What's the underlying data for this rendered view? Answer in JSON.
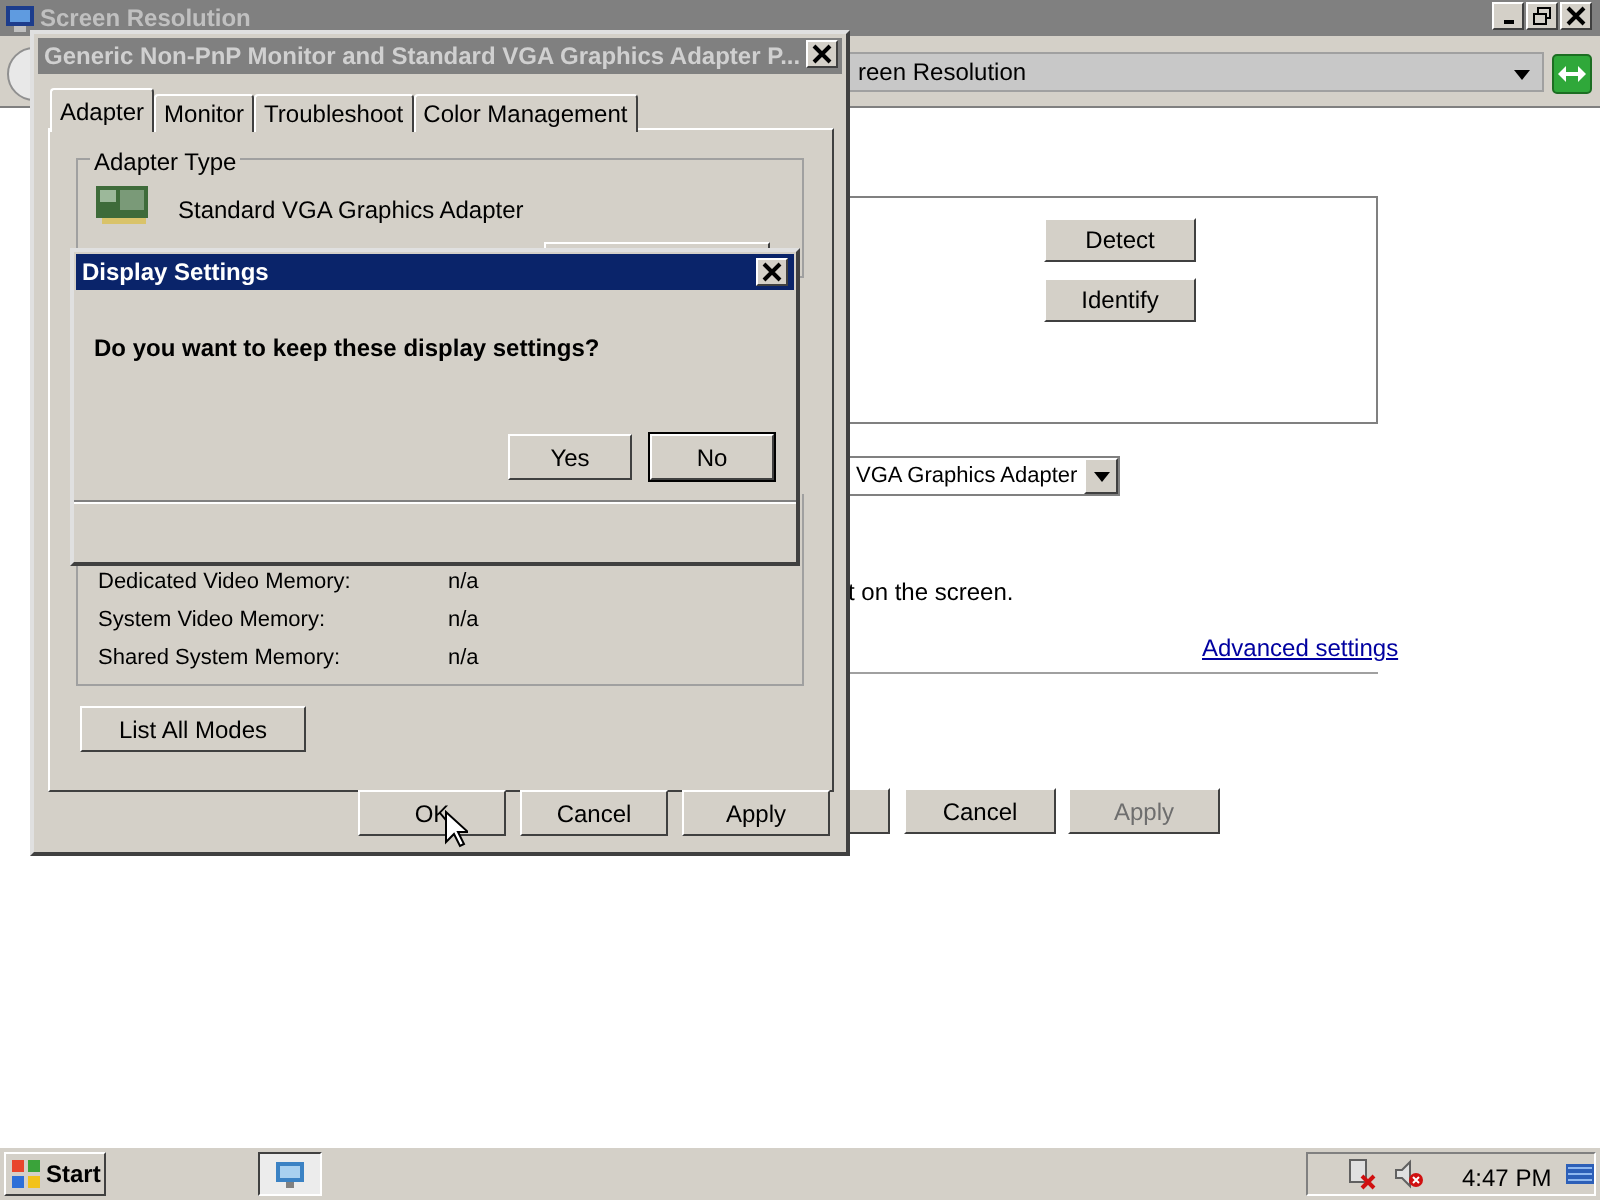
{
  "main_window": {
    "title": "Screen Resolution",
    "address": "reen Resolution",
    "buttons": [
      {
        "label": "Detect",
        "disabled": false
      },
      {
        "label": "Identify",
        "disabled": false
      }
    ],
    "adapter_dropdown": "VGA Graphics Adapter",
    "hint": "t on the screen.",
    "link": "Advanced settings",
    "footer_buttons": [
      {
        "label": "Cancel",
        "disabled": false
      },
      {
        "label": "Apply",
        "disabled": true
      }
    ]
  },
  "properties_dialog": {
    "title": "Generic Non-PnP Monitor and Standard VGA Graphics Adapter P...",
    "tabs": [
      {
        "label": "Adapter",
        "selected": true
      },
      {
        "label": "Monitor",
        "selected": false
      },
      {
        "label": "Troubleshoot",
        "selected": false
      },
      {
        "label": "Color Management",
        "selected": false
      }
    ],
    "adapter_type_label": "Adapter Type",
    "adapter_name": "Standard VGA Graphics Adapter",
    "memory": [
      {
        "label": "Dedicated Video Memory:",
        "value": "n/a"
      },
      {
        "label": "System Video Memory:",
        "value": "n/a"
      },
      {
        "label": "Shared System Memory:",
        "value": "n/a"
      }
    ],
    "list_modes_button": "List All Modes",
    "buttons": [
      "OK",
      "Cancel",
      "Apply"
    ]
  },
  "message_dialog": {
    "title": "Display Settings",
    "message": "Do you want to keep these display settings?",
    "buttons": [
      {
        "label": "Yes",
        "default": false
      },
      {
        "label": "No",
        "default": true
      }
    ]
  },
  "taskbar": {
    "start": "Start",
    "time": "4:47 PM"
  }
}
